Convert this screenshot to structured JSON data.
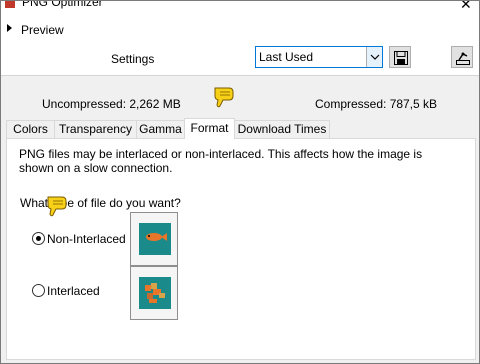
{
  "window": {
    "title": "PNG Optimizer",
    "close_glyph": "✕"
  },
  "preview": {
    "label": "Preview"
  },
  "settings": {
    "label": "Settings",
    "preset_value": "Last Used"
  },
  "sizes": {
    "uncompressed": "Uncompressed:  2,262 MB",
    "compressed": "Compressed: 787,5 kB"
  },
  "tabs": [
    {
      "label": "Colors"
    },
    {
      "label": "Transparency"
    },
    {
      "label": "Gamma"
    },
    {
      "label": "Format"
    },
    {
      "label": "Download Times"
    }
  ],
  "active_tab": "Format",
  "format": {
    "description": "PNG files may be interlaced or non-interlaced. This affects how the image is shown on a slow connection.",
    "question": "What type of file do you want?",
    "options": [
      {
        "label": "Non-Interlaced",
        "selected": true
      },
      {
        "label": "Interlaced",
        "selected": false
      }
    ]
  },
  "colors": {
    "accent": "#0078d7",
    "panel_bg": "#f0f0f0",
    "preview_teal": "#1b8a8a",
    "pointer_yellow": "#f7d117"
  },
  "icons": [
    "app-icon",
    "close-icon",
    "expand-arrow-icon",
    "dropdown-chevron-icon",
    "save-icon",
    "manage-presets-icon",
    "hand-pointer-icon"
  ]
}
